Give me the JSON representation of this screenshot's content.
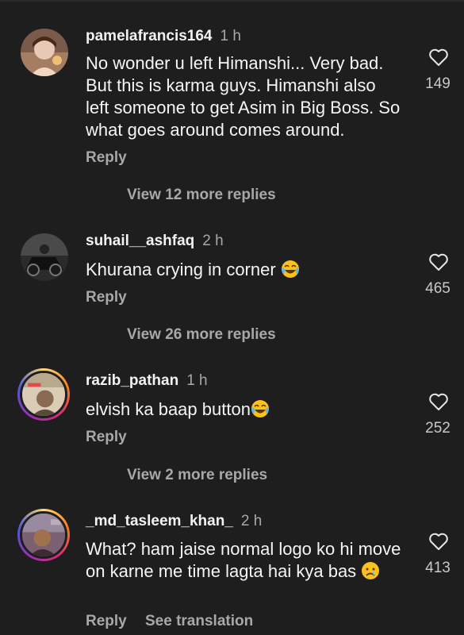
{
  "theme": {
    "background": "#1e1e1e",
    "text": "#f5f5f5",
    "muted": "#a8a8a8",
    "story_ring": [
      "#feda75",
      "#fa7e1e",
      "#d62976",
      "#962fbf",
      "#4f5bd5"
    ]
  },
  "comments": [
    {
      "username": "pamelafrancis164",
      "time": "1 h",
      "text": "No wonder u left Himanshi... Very bad. But this is karma guys. Himanshi also left someone to get Asim in Big Boss. So what goes around comes around.",
      "likes": "149",
      "reply_label": "Reply",
      "view_replies": "View 12 more replies",
      "avatar_icon": "avatar-photo",
      "has_story_ring": false
    },
    {
      "username": "suhail__ashfaq",
      "time": "2 h",
      "text": "Khurana crying in corner",
      "emoji": "face-with-tears-of-joy",
      "likes": "465",
      "reply_label": "Reply",
      "view_replies": "View 26 more replies",
      "avatar_icon": "avatar-photo",
      "has_story_ring": false
    },
    {
      "username": "razib_pathan",
      "time": "1 h",
      "text": "elvish ka baap button",
      "emoji": "face-with-tears-of-joy",
      "likes": "252",
      "reply_label": "Reply",
      "view_replies": "View 2 more replies",
      "avatar_icon": "avatar-photo",
      "has_story_ring": true
    },
    {
      "username": "_md_tasleem_khan_",
      "time": "2 h",
      "text": "What? ham jaise normal logo ko hi move on karne me time lagta hai kya bas",
      "emoji": "crying-face",
      "likes": "413",
      "reply_label": "Reply",
      "see_translation": "See translation",
      "avatar_icon": "avatar-photo",
      "has_story_ring": true
    }
  ],
  "icons": {
    "like": "heart-outline-icon"
  }
}
